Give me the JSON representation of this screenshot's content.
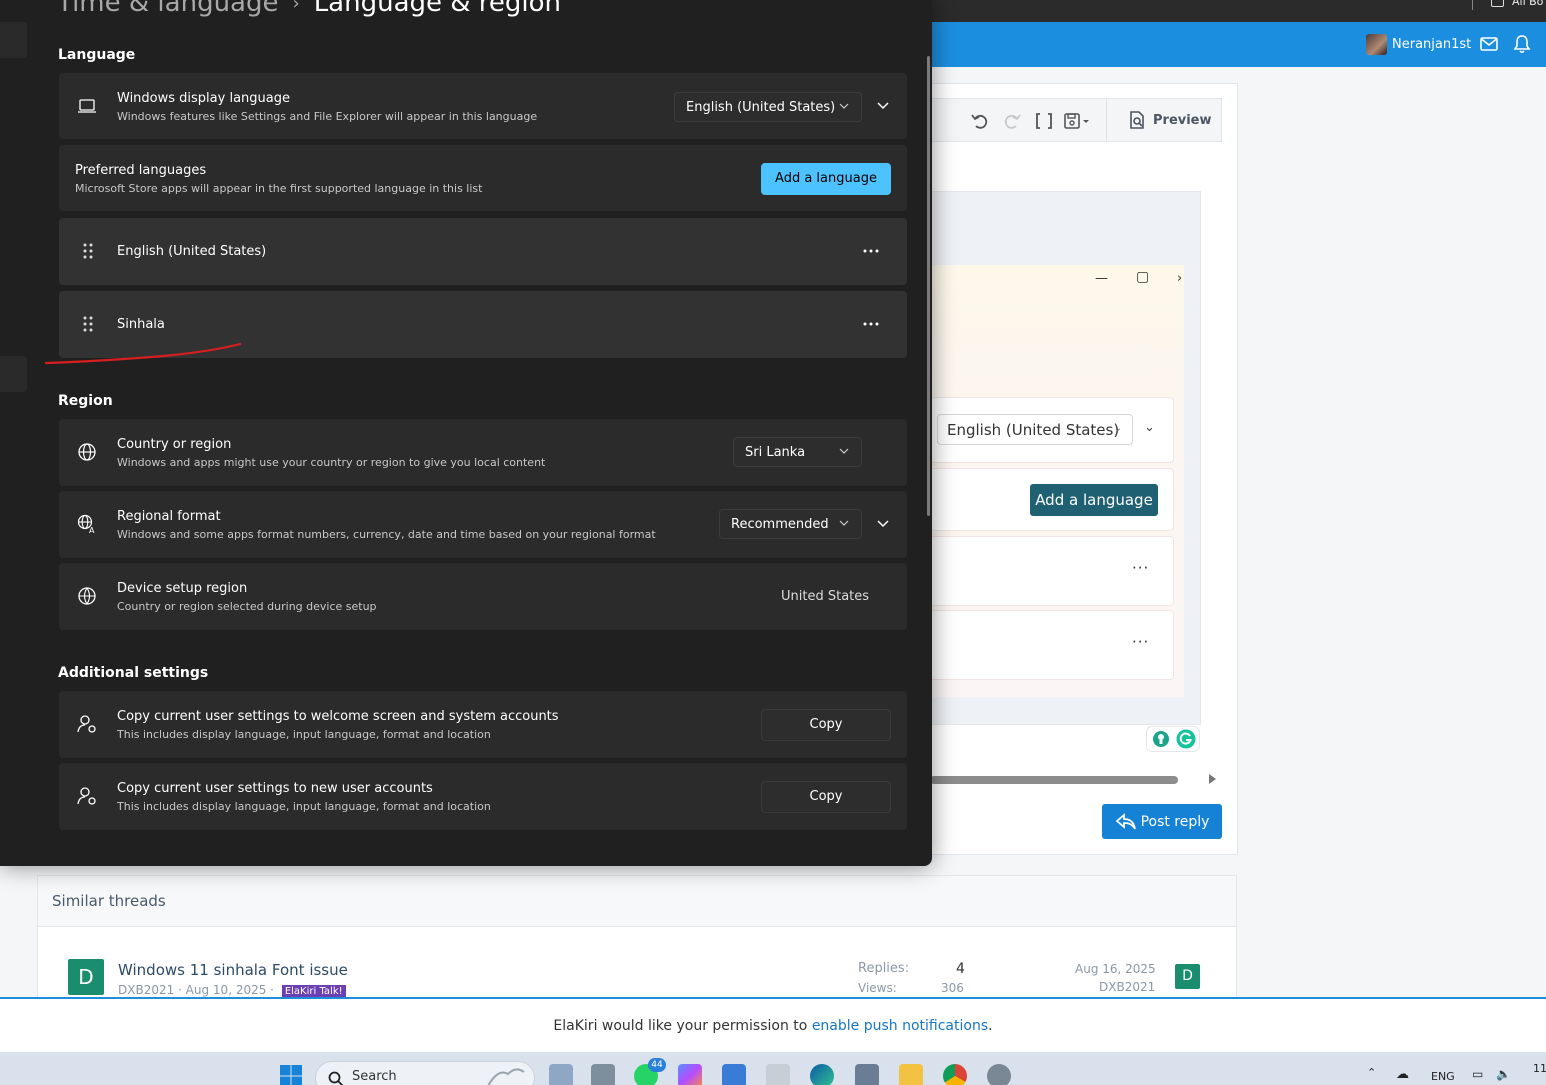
{
  "browser": {
    "bookmarks_label": "All Bo"
  },
  "forum": {
    "username": "Neranjan1st",
    "toolbar": {
      "preview_label": "Preview"
    },
    "pasted": {
      "display_language_value": "English (United States)",
      "add_language_label": "Add a language"
    },
    "post_reply_label": "Post reply",
    "similar_threads_title": "Similar threads",
    "thread": {
      "avatar_letter": "D",
      "title": "Windows 11 sinhala Font issue",
      "meta": "DXB2021 · Aug 10, 2025 ·",
      "tag": "ElaKiri Talk!",
      "replies_label": "Replies:",
      "replies_value": "4",
      "views_label": "Views:",
      "views_value": "306",
      "last_date": "Aug 16, 2025",
      "last_user": "DXB2021",
      "last_avatar_letter": "D"
    },
    "push": {
      "prefix": "ElaKiri would like your permission to ",
      "link": "enable push notifications",
      "suffix": "."
    }
  },
  "taskbar": {
    "search_placeholder": "Search",
    "whatsapp_badge": "44",
    "tray_lang": "ENG",
    "clock_partial": "11"
  },
  "settings": {
    "breadcrumb": {
      "parent": "Time & language",
      "current": "Language & region"
    },
    "language": {
      "section_title": "Language",
      "display_language": {
        "title": "Windows display language",
        "desc": "Windows features like Settings and File Explorer will appear in this language",
        "value": "English (United States)"
      },
      "preferred": {
        "title": "Preferred languages",
        "desc": "Microsoft Store apps will appear in the first supported language in this list",
        "add_button": "Add a language"
      },
      "installed": [
        "English (United States)",
        "Sinhala"
      ]
    },
    "region": {
      "section_title": "Region",
      "country": {
        "title": "Country or region",
        "desc": "Windows and apps might use your country or region to give you local content",
        "value": "Sri Lanka"
      },
      "format": {
        "title": "Regional format",
        "desc": "Windows and some apps format numbers, currency, date and time based on your regional format",
        "value": "Recommended"
      },
      "device_setup": {
        "title": "Device setup region",
        "desc": "Country or region selected during device setup",
        "value": "United States"
      }
    },
    "additional": {
      "section_title": "Additional settings",
      "copy_welcome": {
        "title": "Copy current user settings to welcome screen and system accounts",
        "desc": "This includes display language, input language, format and location",
        "button": "Copy"
      },
      "copy_new": {
        "title": "Copy current user settings to new user accounts",
        "desc": "This includes display language, input language, format and location",
        "button": "Copy"
      }
    }
  },
  "colors": {
    "settings_bg": "#202020",
    "card_bg": "#2b2b2b",
    "accent": "#4cc2ff",
    "forum_blue": "#1c8ee0",
    "annotation_red": "#d81e1e"
  }
}
